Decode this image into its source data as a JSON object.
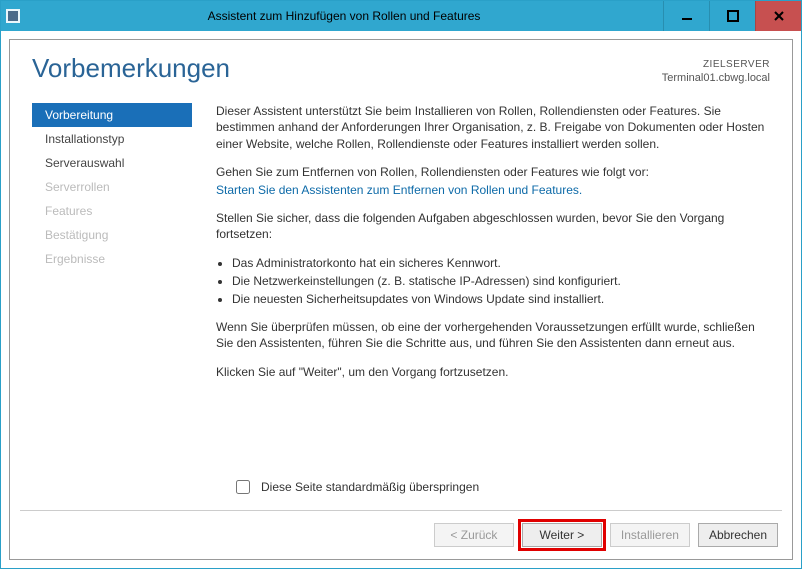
{
  "window": {
    "title": "Assistent zum Hinzufügen von Rollen und Features"
  },
  "header": {
    "page_title": "Vorbemerkungen",
    "target_label": "ZIELSERVER",
    "target_server": "Terminal01.cbwg.local"
  },
  "nav": {
    "items": [
      {
        "label": "Vorbereitung",
        "state": "active"
      },
      {
        "label": "Installationstyp",
        "state": "enabled"
      },
      {
        "label": "Serverauswahl",
        "state": "enabled"
      },
      {
        "label": "Serverrollen",
        "state": "disabled"
      },
      {
        "label": "Features",
        "state": "disabled"
      },
      {
        "label": "Bestätigung",
        "state": "disabled"
      },
      {
        "label": "Ergebnisse",
        "state": "disabled"
      }
    ]
  },
  "content": {
    "intro": "Dieser Assistent unterstützt Sie beim Installieren von Rollen, Rollendiensten oder Features. Sie bestimmen anhand der Anforderungen Ihrer Organisation, z. B. Freigabe von Dokumenten oder Hosten einer Website, welche Rollen, Rollendienste oder Features installiert werden sollen.",
    "remove_lead": "Gehen Sie zum Entfernen von Rollen, Rollendiensten oder Features wie folgt vor:",
    "remove_link": "Starten Sie den Assistenten zum Entfernen von Rollen und Features.",
    "ensure_lead": "Stellen Sie sicher, dass die folgenden Aufgaben abgeschlossen wurden, bevor Sie den Vorgang fortsetzen:",
    "bullets": [
      "Das Administratorkonto hat ein sicheres Kennwort.",
      "Die Netzwerkeinstellungen (z. B. statische IP-Adressen) sind konfiguriert.",
      "Die neuesten Sicherheitsupdates von Windows Update sind installiert."
    ],
    "recheck": "Wenn Sie überprüfen müssen, ob eine der vorhergehenden Voraussetzungen erfüllt wurde, schließen Sie den Assistenten, führen Sie die Schritte aus, und führen Sie den Assistenten dann erneut aus.",
    "continue_hint": "Klicken Sie auf \"Weiter\", um den Vorgang fortzusetzen.",
    "skip_label": "Diese Seite standardmäßig überspringen"
  },
  "buttons": {
    "back": "< Zurück",
    "next": "Weiter >",
    "install": "Installieren",
    "cancel": "Abbrechen"
  }
}
